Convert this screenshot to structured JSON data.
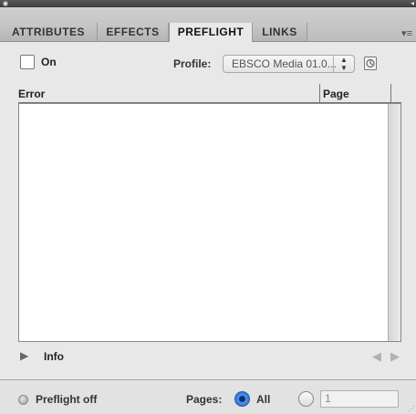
{
  "window": {
    "title": ""
  },
  "tabs": [
    {
      "label": "ATTRIBUTES",
      "active": false
    },
    {
      "label": "EFFECTS",
      "active": false
    },
    {
      "label": "PREFLIGHT",
      "active": true
    },
    {
      "label": "LINKS",
      "active": false
    }
  ],
  "toolbar": {
    "on_label": "On",
    "on_checked": false,
    "profile_label": "Profile:",
    "profile_value": "EBSCO Media 01.0...",
    "profile_icon": "profile-definitions-icon"
  },
  "table": {
    "columns": [
      "Error",
      "Page"
    ],
    "rows": []
  },
  "info": {
    "label": "Info",
    "expanded": false
  },
  "status": {
    "indicator": "gray",
    "text": "Preflight off",
    "pages_label": "Pages:",
    "all_label": "All",
    "range_value": "1",
    "all_selected": true
  },
  "colors": {
    "panel_bg": "#e8e8e8",
    "tabbar_bg": "#c4c4c4",
    "radio_selected": "#2d6fc9"
  }
}
